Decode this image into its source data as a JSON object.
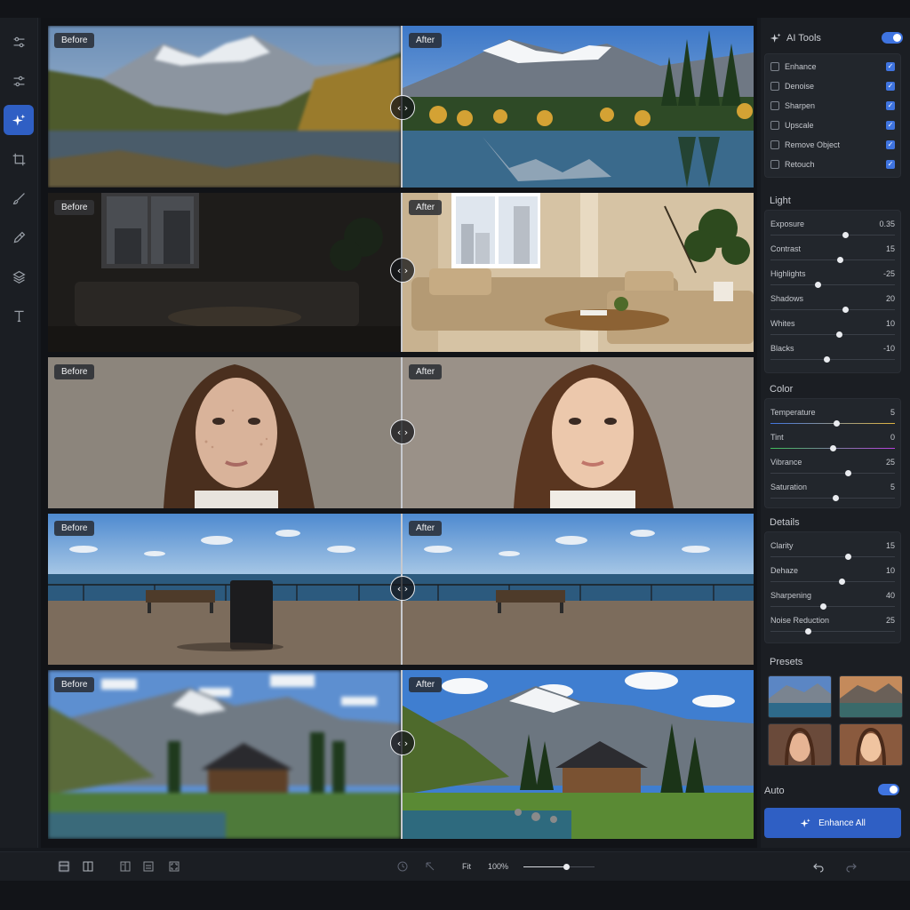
{
  "sidebar": {
    "tools": [
      {
        "icon": "adjustments-icon"
      },
      {
        "icon": "sliders-icon"
      },
      {
        "icon": "ai-sparkle-icon",
        "active": true
      },
      {
        "icon": "crop-icon"
      },
      {
        "icon": "brush-icon"
      },
      {
        "icon": "eyedropper-icon"
      },
      {
        "icon": "layers-icon"
      },
      {
        "icon": "text-icon"
      }
    ]
  },
  "comparisons": [
    {
      "name": "mountain-lake",
      "before": "Before",
      "after": "After",
      "handle": "‹ ›"
    },
    {
      "name": "living-room",
      "before": "Before",
      "after": "After",
      "handle": "‹ ›"
    },
    {
      "name": "portrait",
      "before": "Before",
      "after": "After",
      "handle": "‹ ›"
    },
    {
      "name": "seaside-boardwalk",
      "before": "Before",
      "after": "After",
      "handle": "‹ ›"
    },
    {
      "name": "cabin-landscape",
      "before": "Before",
      "after": "After",
      "handle": "‹ ›"
    }
  ],
  "panel": {
    "ai_tools": {
      "title": "AI Tools",
      "enabled": true,
      "items": [
        {
          "label": "Enhance",
          "icon": "enhance-icon",
          "checked": true
        },
        {
          "label": "Denoise",
          "icon": "denoise-icon",
          "checked": true
        },
        {
          "label": "Sharpen",
          "icon": "sharpen-icon",
          "checked": true
        },
        {
          "label": "Upscale",
          "icon": "upscale-icon",
          "checked": true
        },
        {
          "label": "Remove Object",
          "icon": "remove-object-icon",
          "checked": true
        },
        {
          "label": "Retouch",
          "icon": "retouch-icon",
          "checked": true
        }
      ]
    },
    "light": {
      "title": "Light",
      "sliders": [
        {
          "label": "Exposure",
          "value": "0.35",
          "level": 0.6
        },
        {
          "label": "Contrast",
          "value": "15",
          "level": 0.56
        },
        {
          "label": "Highlights",
          "value": "-25",
          "level": 0.38
        },
        {
          "label": "Shadows",
          "value": "20",
          "level": 0.6
        },
        {
          "label": "Whites",
          "value": "10",
          "level": 0.55
        },
        {
          "label": "Blacks",
          "value": "-10",
          "level": 0.45
        }
      ]
    },
    "color": {
      "title": "Color",
      "sliders": [
        {
          "label": "Temperature",
          "value": "5",
          "level": 0.53
        },
        {
          "label": "Tint",
          "value": "0",
          "level": 0.5
        },
        {
          "label": "Vibrance",
          "value": "25",
          "level": 0.62
        },
        {
          "label": "Saturation",
          "value": "5",
          "level": 0.52
        }
      ]
    },
    "details": {
      "title": "Details",
      "sliders": [
        {
          "label": "Clarity",
          "value": "15",
          "level": 0.62
        },
        {
          "label": "Dehaze",
          "value": "10",
          "level": 0.57
        },
        {
          "label": "Sharpening",
          "value": "40",
          "level": 0.42
        },
        {
          "label": "Noise Reduction",
          "value": "25",
          "level": 0.3
        }
      ]
    },
    "presets": {
      "title": "Presets",
      "items": [
        "preset-lake-cool",
        "preset-lake-warm",
        "preset-portrait-warm",
        "preset-portrait-sunset"
      ]
    },
    "auto": {
      "label": "Auto",
      "enabled": true
    },
    "enhance_all": "Enhance All"
  },
  "bottom": {
    "fit_label": "Fit",
    "zoom": "100%",
    "zoom_level": 0.6
  },
  "colors": {
    "accent": "#3f74e0",
    "button": "#2f5fc4"
  }
}
